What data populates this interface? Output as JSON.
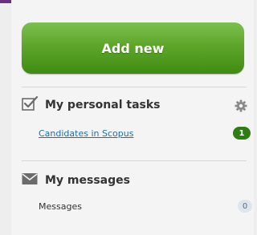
{
  "actions": {
    "add_new_label": "Add new"
  },
  "tasks": {
    "title": "My personal tasks",
    "items": [
      {
        "label": "Candidates in Scopus",
        "count": "1"
      }
    ]
  },
  "messages": {
    "title": "My messages",
    "items": [
      {
        "label": "Messages",
        "count": "0"
      }
    ]
  },
  "colors": {
    "button_green": "#5ea62a",
    "badge_green": "#2e7d12",
    "link_blue": "#1f6fa8"
  }
}
